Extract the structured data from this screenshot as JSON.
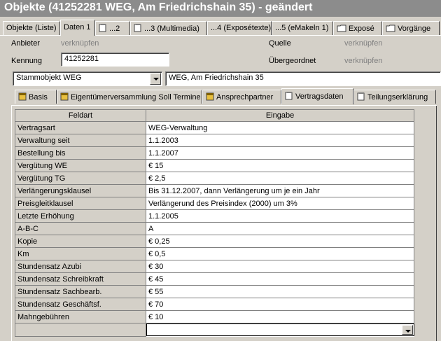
{
  "window": {
    "title": "Objekte (41252281 WEG, Am Friedrichshain 35) - geändert"
  },
  "main_tabs": [
    {
      "label": "Objekte (Liste)",
      "icon": ""
    },
    {
      "label": "Daten 1",
      "icon": "",
      "active": true
    },
    {
      "label": "...2",
      "icon": "page-icon"
    },
    {
      "label": "...3 (Multimedia)",
      "icon": "page-icon"
    },
    {
      "label": "...4 (Exposétexte)",
      "icon": ""
    },
    {
      "label": "...5 (eMakeln 1)",
      "icon": ""
    },
    {
      "label": "Exposé",
      "icon": "folder-icon"
    },
    {
      "label": "Vorgänge",
      "icon": "folder-icon"
    }
  ],
  "header": {
    "anbieter_label": "Anbieter",
    "anbieter_link": "verknüpfen",
    "quelle_label": "Quelle",
    "quelle_link": "verknüpfen",
    "kennung_label": "Kennung",
    "kennung_value": "41252281",
    "uebergeordnet_label": "Übergeordnet",
    "uebergeordnet_link": "verknüpfen",
    "objekttyp_value": "Stammobjekt WEG",
    "bezeichnung_value": "WEG, Am Friedrichshain 35"
  },
  "sub_tabs": [
    {
      "label": "Basis",
      "icon": "yellow-tab-icon"
    },
    {
      "label": "Eigentümerversammlung Soll Termine",
      "icon": "yellow-tab-icon"
    },
    {
      "label": "Ansprechpartner",
      "icon": "yellow-tab-icon"
    },
    {
      "label": "Vertragsdaten",
      "icon": "page-icon",
      "active": true
    },
    {
      "label": "Teilungserklärung",
      "icon": "page-icon"
    }
  ],
  "grid": {
    "headers": [
      "Feldart",
      "Eingabe"
    ],
    "rows": [
      [
        "Vertragsart",
        "WEG-Verwaltung"
      ],
      [
        "Verwaltung seit",
        "1.1.2003"
      ],
      [
        "Bestellung bis",
        "1.1.2007"
      ],
      [
        "Vergütung WE",
        "€ 15"
      ],
      [
        "Vergütung TG",
        "€ 2,5"
      ],
      [
        "Verlängerungsklausel",
        "Bis 31.12.2007, dann Verlängerung um je ein Jahr"
      ],
      [
        "Preisgleitklausel",
        "Verlängerund des Preisindex (2000) um 3%"
      ],
      [
        "Letzte Erhöhung",
        "1.1.2005"
      ],
      [
        "A-B-C",
        "A"
      ],
      [
        "Kopie",
        "€ 0,25"
      ],
      [
        "Km",
        "€ 0,5"
      ],
      [
        "Stundensatz Azubi",
        "€ 30"
      ],
      [
        "Stundensatz Schreibkraft",
        "€ 45"
      ],
      [
        "Stundensatz Sachbearb.",
        "€ 55"
      ],
      [
        "Stundensatz Geschäftsf.",
        "€ 70"
      ],
      [
        "Mahngebühren",
        "€ 10"
      ]
    ],
    "edit_value": ""
  },
  "colors": {
    "titlebar": "#8c8c8c",
    "face": "#d4d0c8",
    "tab_icon_yellow": "#e8c040"
  }
}
